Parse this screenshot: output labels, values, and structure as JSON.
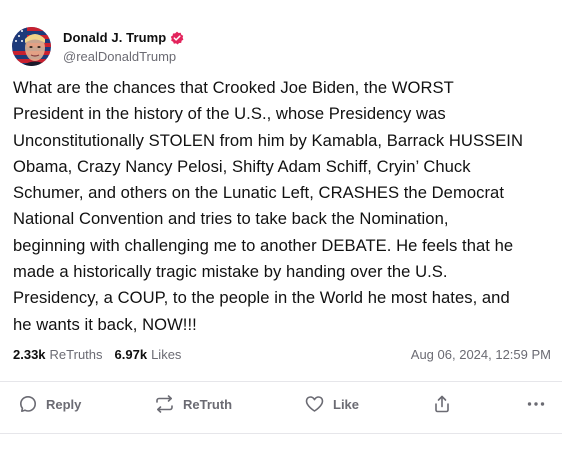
{
  "author": {
    "display_name": "Donald J. Trump",
    "handle": "@realDonaldTrump",
    "verified": true,
    "avatar_icon": "profile-avatar"
  },
  "post": {
    "text_lines": [
      "What are the chances that Crooked Joe Biden, the WORST",
      "President in the history of the U.S., whose Presidency was",
      "Unconstitutionally STOLEN from him by Kamabla, Barrack HUSSEIN",
      "Obama, Crazy Nancy Pelosi, Shifty Adam Schiff, Cryin’ Chuck",
      "Schumer, and others on the Lunatic Left, CRASHES the Democrat",
      "National Convention and tries to take back the Nomination,",
      "beginning with challenging me to another DEBATE. He feels that he",
      "made a historically tragic mistake by handing over the U.S.",
      "Presidency, a COUP, to the people in the World he most hates, and",
      "he wants it back, NOW!!!"
    ]
  },
  "stats": {
    "retruths_count": "2.33k",
    "retruths_label": "ReTruths",
    "likes_count": "6.97k",
    "likes_label": "Likes",
    "timestamp": "Aug 06, 2024, 12:59 PM"
  },
  "actions": {
    "reply_label": "Reply",
    "retruth_label": "ReTruth",
    "like_label": "Like"
  },
  "colors": {
    "text": "#0f0f0f",
    "muted": "#6b6b73",
    "verified_badge": "#e3245c",
    "divider": "#e6e6ea"
  }
}
